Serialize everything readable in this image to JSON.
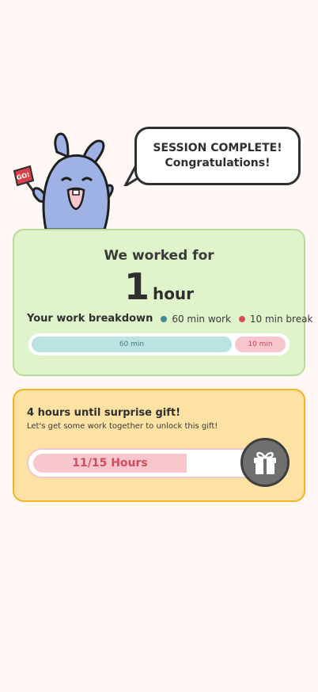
{
  "hero": {
    "flag_text": "GO!",
    "bubble_line1": "SESSION COMPLETE!",
    "bubble_line2": "Congratulations!"
  },
  "worked": {
    "title": "We worked for",
    "amount": "1",
    "unit": "hour",
    "breakdown_label": "Your work breakdown",
    "legend_work": "60 min work",
    "legend_break": "10 min break",
    "bar_work_label": "60 min",
    "bar_break_label": "10 min",
    "work_minutes": 60,
    "break_minutes": 10
  },
  "gift": {
    "title": "4 hours until surprise gift!",
    "subtitle": "Let's get some work together to unlock this gift!",
    "progress_label": "11/15 Hours",
    "progress_value": 11,
    "progress_max": 15,
    "icon": "gift-icon"
  },
  "colors": {
    "background": "#fff8f5",
    "worked_card": "#e0f4cb",
    "gift_card": "#fde2a4",
    "work_color": "#3f8c91",
    "break_color": "#d84c5b"
  }
}
